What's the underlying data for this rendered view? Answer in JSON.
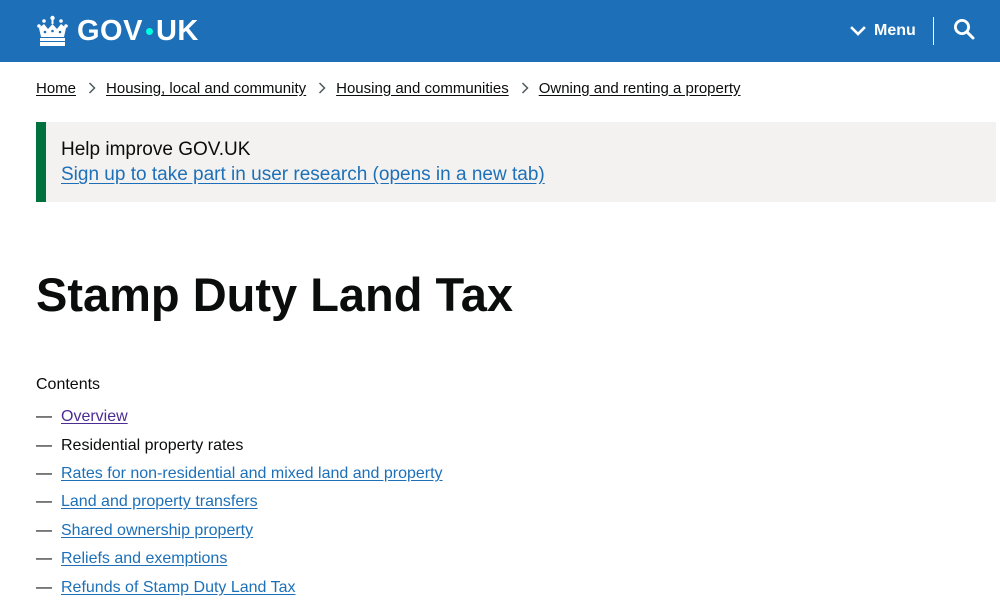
{
  "header": {
    "logo_text_left": "GOV",
    "logo_text_right": "UK",
    "logo_icon": "crown-icon",
    "menu_label": "Menu",
    "menu_icon": "chevron-down-icon",
    "search_icon": "search-icon",
    "background_color": "#1d70b8"
  },
  "breadcrumb": {
    "items": [
      {
        "label": "Home"
      },
      {
        "label": "Housing, local and community"
      },
      {
        "label": "Housing and communities"
      },
      {
        "label": "Owning and renting a property"
      }
    ],
    "separator_icon": "chevron-right-icon"
  },
  "banner": {
    "title": "Help improve GOV.UK",
    "link": "Sign up to take part in user research (opens in a new tab)",
    "accent_color": "#00703c"
  },
  "page": {
    "title": "Stamp Duty Land Tax"
  },
  "contents": {
    "heading": "Contents",
    "dash": "—",
    "items": [
      {
        "label": "Overview",
        "state": "visited"
      },
      {
        "label": "Residential property rates",
        "state": "current"
      },
      {
        "label": "Rates for non-residential and mixed land and property",
        "state": "link"
      },
      {
        "label": "Land and property transfers",
        "state": "link"
      },
      {
        "label": "Shared ownership property",
        "state": "link"
      },
      {
        "label": "Reliefs and exemptions",
        "state": "link"
      },
      {
        "label": "Refunds of Stamp Duty Land Tax",
        "state": "link"
      }
    ]
  },
  "colors": {
    "link": "#1d70b8",
    "visited_link": "#4c2c92",
    "text": "#0b0c0c"
  }
}
